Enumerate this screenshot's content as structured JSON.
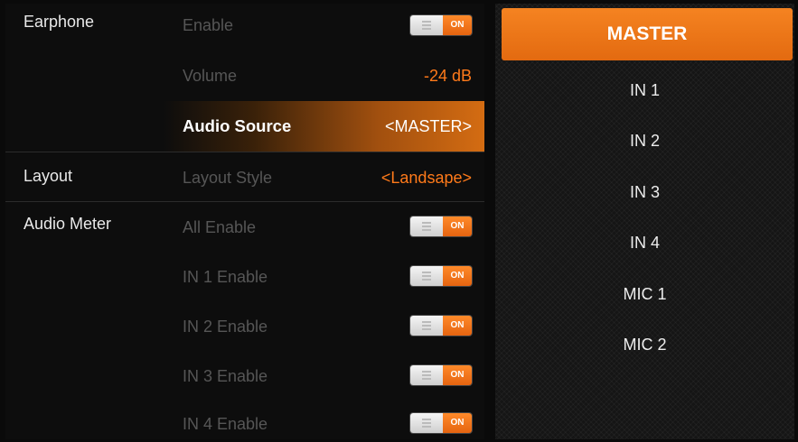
{
  "categories": {
    "earphone": "Earphone",
    "layout": "Layout",
    "audio_meter": "Audio Meter"
  },
  "earphone": {
    "enable_label": "Enable",
    "enable_state": "ON",
    "volume_label": "Volume",
    "volume_value": "-24 dB",
    "audio_source_label": "Audio Source",
    "audio_source_value": "<MASTER>"
  },
  "layout": {
    "style_label": "Layout Style",
    "style_value": "<Landsape>"
  },
  "audio_meter": {
    "items": [
      {
        "label": "All Enable",
        "state": "ON"
      },
      {
        "label": "IN 1 Enable",
        "state": "ON"
      },
      {
        "label": "IN 2 Enable",
        "state": "ON"
      },
      {
        "label": "IN 3 Enable",
        "state": "ON"
      },
      {
        "label": "IN 4 Enable",
        "state": "ON"
      }
    ]
  },
  "source_list": {
    "selected": "MASTER",
    "options": [
      "IN 1",
      "IN 2",
      "IN 3",
      "IN 4",
      "MIC 1",
      "MIC 2"
    ]
  },
  "colors": {
    "accent": "#f07518",
    "value_text": "#ff7a1a",
    "dim_label": "#565656",
    "background": "#0a0a0a"
  }
}
